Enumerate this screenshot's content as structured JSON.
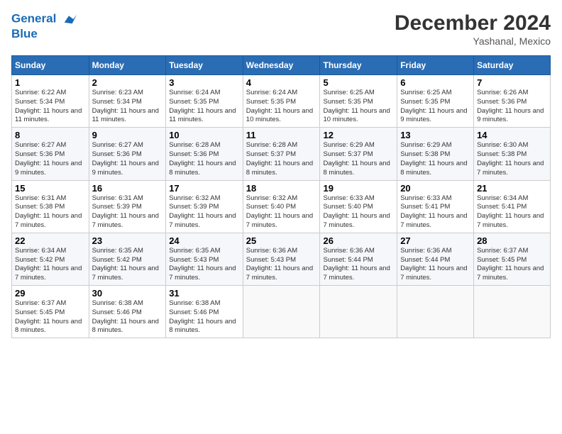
{
  "header": {
    "logo_line1": "General",
    "logo_line2": "Blue",
    "month": "December 2024",
    "location": "Yashanal, Mexico"
  },
  "days_of_week": [
    "Sunday",
    "Monday",
    "Tuesday",
    "Wednesday",
    "Thursday",
    "Friday",
    "Saturday"
  ],
  "weeks": [
    [
      {
        "day": "1",
        "sunrise": "Sunrise: 6:22 AM",
        "sunset": "Sunset: 5:34 PM",
        "daylight": "Daylight: 11 hours and 11 minutes."
      },
      {
        "day": "2",
        "sunrise": "Sunrise: 6:23 AM",
        "sunset": "Sunset: 5:34 PM",
        "daylight": "Daylight: 11 hours and 11 minutes."
      },
      {
        "day": "3",
        "sunrise": "Sunrise: 6:24 AM",
        "sunset": "Sunset: 5:35 PM",
        "daylight": "Daylight: 11 hours and 11 minutes."
      },
      {
        "day": "4",
        "sunrise": "Sunrise: 6:24 AM",
        "sunset": "Sunset: 5:35 PM",
        "daylight": "Daylight: 11 hours and 10 minutes."
      },
      {
        "day": "5",
        "sunrise": "Sunrise: 6:25 AM",
        "sunset": "Sunset: 5:35 PM",
        "daylight": "Daylight: 11 hours and 10 minutes."
      },
      {
        "day": "6",
        "sunrise": "Sunrise: 6:25 AM",
        "sunset": "Sunset: 5:35 PM",
        "daylight": "Daylight: 11 hours and 9 minutes."
      },
      {
        "day": "7",
        "sunrise": "Sunrise: 6:26 AM",
        "sunset": "Sunset: 5:36 PM",
        "daylight": "Daylight: 11 hours and 9 minutes."
      }
    ],
    [
      {
        "day": "8",
        "sunrise": "Sunrise: 6:27 AM",
        "sunset": "Sunset: 5:36 PM",
        "daylight": "Daylight: 11 hours and 9 minutes."
      },
      {
        "day": "9",
        "sunrise": "Sunrise: 6:27 AM",
        "sunset": "Sunset: 5:36 PM",
        "daylight": "Daylight: 11 hours and 9 minutes."
      },
      {
        "day": "10",
        "sunrise": "Sunrise: 6:28 AM",
        "sunset": "Sunset: 5:36 PM",
        "daylight": "Daylight: 11 hours and 8 minutes."
      },
      {
        "day": "11",
        "sunrise": "Sunrise: 6:28 AM",
        "sunset": "Sunset: 5:37 PM",
        "daylight": "Daylight: 11 hours and 8 minutes."
      },
      {
        "day": "12",
        "sunrise": "Sunrise: 6:29 AM",
        "sunset": "Sunset: 5:37 PM",
        "daylight": "Daylight: 11 hours and 8 minutes."
      },
      {
        "day": "13",
        "sunrise": "Sunrise: 6:29 AM",
        "sunset": "Sunset: 5:38 PM",
        "daylight": "Daylight: 11 hours and 8 minutes."
      },
      {
        "day": "14",
        "sunrise": "Sunrise: 6:30 AM",
        "sunset": "Sunset: 5:38 PM",
        "daylight": "Daylight: 11 hours and 7 minutes."
      }
    ],
    [
      {
        "day": "15",
        "sunrise": "Sunrise: 6:31 AM",
        "sunset": "Sunset: 5:38 PM",
        "daylight": "Daylight: 11 hours and 7 minutes."
      },
      {
        "day": "16",
        "sunrise": "Sunrise: 6:31 AM",
        "sunset": "Sunset: 5:39 PM",
        "daylight": "Daylight: 11 hours and 7 minutes."
      },
      {
        "day": "17",
        "sunrise": "Sunrise: 6:32 AM",
        "sunset": "Sunset: 5:39 PM",
        "daylight": "Daylight: 11 hours and 7 minutes."
      },
      {
        "day": "18",
        "sunrise": "Sunrise: 6:32 AM",
        "sunset": "Sunset: 5:40 PM",
        "daylight": "Daylight: 11 hours and 7 minutes."
      },
      {
        "day": "19",
        "sunrise": "Sunrise: 6:33 AM",
        "sunset": "Sunset: 5:40 PM",
        "daylight": "Daylight: 11 hours and 7 minutes."
      },
      {
        "day": "20",
        "sunrise": "Sunrise: 6:33 AM",
        "sunset": "Sunset: 5:41 PM",
        "daylight": "Daylight: 11 hours and 7 minutes."
      },
      {
        "day": "21",
        "sunrise": "Sunrise: 6:34 AM",
        "sunset": "Sunset: 5:41 PM",
        "daylight": "Daylight: 11 hours and 7 minutes."
      }
    ],
    [
      {
        "day": "22",
        "sunrise": "Sunrise: 6:34 AM",
        "sunset": "Sunset: 5:42 PM",
        "daylight": "Daylight: 11 hours and 7 minutes."
      },
      {
        "day": "23",
        "sunrise": "Sunrise: 6:35 AM",
        "sunset": "Sunset: 5:42 PM",
        "daylight": "Daylight: 11 hours and 7 minutes."
      },
      {
        "day": "24",
        "sunrise": "Sunrise: 6:35 AM",
        "sunset": "Sunset: 5:43 PM",
        "daylight": "Daylight: 11 hours and 7 minutes."
      },
      {
        "day": "25",
        "sunrise": "Sunrise: 6:36 AM",
        "sunset": "Sunset: 5:43 PM",
        "daylight": "Daylight: 11 hours and 7 minutes."
      },
      {
        "day": "26",
        "sunrise": "Sunrise: 6:36 AM",
        "sunset": "Sunset: 5:44 PM",
        "daylight": "Daylight: 11 hours and 7 minutes."
      },
      {
        "day": "27",
        "sunrise": "Sunrise: 6:36 AM",
        "sunset": "Sunset: 5:44 PM",
        "daylight": "Daylight: 11 hours and 7 minutes."
      },
      {
        "day": "28",
        "sunrise": "Sunrise: 6:37 AM",
        "sunset": "Sunset: 5:45 PM",
        "daylight": "Daylight: 11 hours and 7 minutes."
      }
    ],
    [
      {
        "day": "29",
        "sunrise": "Sunrise: 6:37 AM",
        "sunset": "Sunset: 5:45 PM",
        "daylight": "Daylight: 11 hours and 8 minutes."
      },
      {
        "day": "30",
        "sunrise": "Sunrise: 6:38 AM",
        "sunset": "Sunset: 5:46 PM",
        "daylight": "Daylight: 11 hours and 8 minutes."
      },
      {
        "day": "31",
        "sunrise": "Sunrise: 6:38 AM",
        "sunset": "Sunset: 5:46 PM",
        "daylight": "Daylight: 11 hours and 8 minutes."
      },
      null,
      null,
      null,
      null
    ]
  ]
}
